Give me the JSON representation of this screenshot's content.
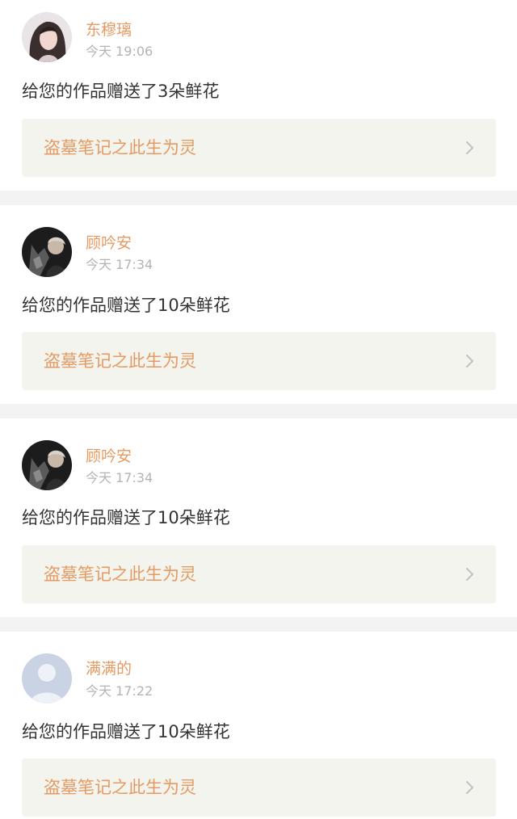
{
  "notifications": [
    {
      "username": "东穆璃",
      "time": "今天 19:06",
      "message": "给您的作品赠送了3朵鲜花",
      "work_title": "盗墓笔记之此生为灵",
      "avatar": "photo-avatar-girl",
      "chevron": "chevron-right-icon"
    },
    {
      "username": "顾吟安",
      "time": "今天 17:34",
      "message": "给您的作品赠送了10朵鲜花",
      "work_title": "盗墓笔记之此生为灵",
      "avatar": "photo-avatar-wolf",
      "chevron": "chevron-right-icon"
    },
    {
      "username": "顾吟安",
      "time": "今天 17:34",
      "message": "给您的作品赠送了10朵鲜花",
      "work_title": "盗墓笔记之此生为灵",
      "avatar": "photo-avatar-wolf",
      "chevron": "chevron-right-icon"
    },
    {
      "username": "满满的",
      "time": "今天 17:22",
      "message": "给您的作品赠送了10朵鲜花",
      "work_title": "盗墓笔记之此生为灵",
      "avatar": "default-avatar",
      "chevron": "chevron-right-icon"
    }
  ],
  "colors": {
    "accent": "#e49a63",
    "card_background": "#ffffff",
    "page_background": "#f3f3f3",
    "link_background": "#f4f4ee",
    "text": "#333333",
    "muted": "#b4b4b4"
  }
}
